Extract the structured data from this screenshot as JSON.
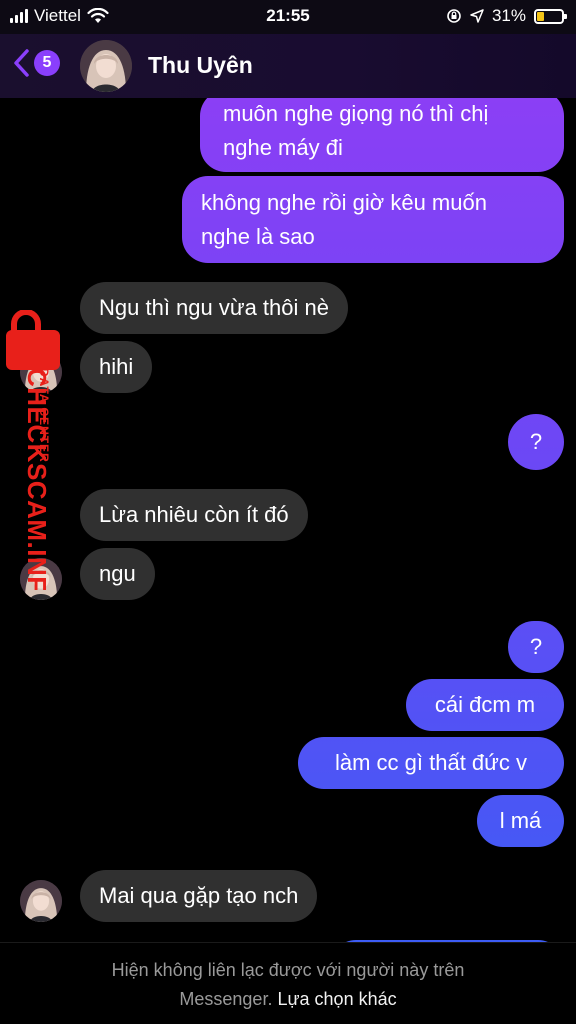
{
  "status_bar": {
    "carrier": "Viettel",
    "time": "21:55",
    "battery_percent": "31%",
    "battery_level": 0.31,
    "icons": [
      "signal-icon",
      "wifi-icon",
      "orientation-lock-icon",
      "location-icon",
      "battery-icon"
    ]
  },
  "header": {
    "back_badge": "5",
    "contact_name": "Thu Uyên"
  },
  "messages": [
    {
      "from": "me",
      "lines": [
        "muôn nghe giọng nó thì chị",
        "nghe máy đi"
      ]
    },
    {
      "from": "me",
      "lines": [
        "không nghe rồi giờ kêu muốn",
        "nghe là sao"
      ]
    },
    {
      "from": "them",
      "text": "Ngu thì ngu vừa thôi nè"
    },
    {
      "from": "them",
      "text": "hihi"
    },
    {
      "from": "me",
      "text": "?"
    },
    {
      "from": "them",
      "text": "Lừa nhiêu còn ít đó"
    },
    {
      "from": "them",
      "text": "ngu"
    },
    {
      "from": "me",
      "text": "?"
    },
    {
      "from": "me",
      "text": "cái đcm m"
    },
    {
      "from": "me",
      "text": "làm cc gì thất đức v"
    },
    {
      "from": "me",
      "text": "l má"
    },
    {
      "from": "them",
      "text": "Mai qua gặp tạo nch"
    }
  ],
  "watermark": {
    "line1": "DATA CENTER",
    "line2": "CHECKSCAM.INFO"
  },
  "footer": {
    "notice_line1": "Hiện không liên lạc được với người này trên",
    "notice_line2": "Messenger.",
    "action_label": "Lựa chọn khác"
  },
  "colors": {
    "accent": "#8a3ffc",
    "bubble_top": "#8b3ff5",
    "bubble_bottom": "#3d5cf5",
    "incoming_bubble": "#303030",
    "watermark_red": "#e8201a"
  }
}
